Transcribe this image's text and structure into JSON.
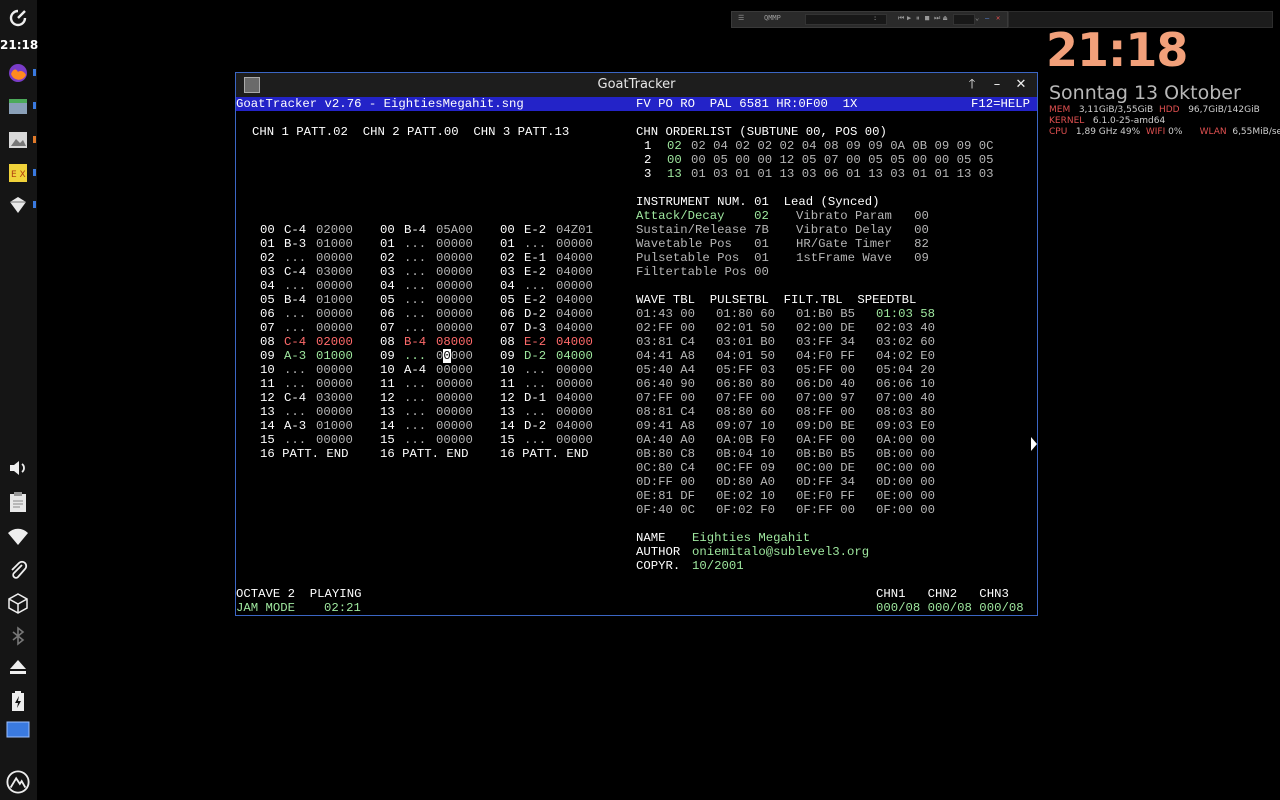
{
  "dock": {
    "time": "21:18",
    "items": [
      "power-icon",
      "firefox-icon",
      "files-icon",
      "image-viewer-icon",
      "notes-icon",
      "media-icon",
      "volume-icon",
      "clipboard-icon",
      "wifi-icon",
      "attachment-icon",
      "package-icon",
      "bluetooth-icon",
      "eject-icon",
      "battery-icon",
      "workspace-icon",
      "logo-icon"
    ],
    "colors": {
      "indicator_blue": "#3a7ae0",
      "indicator_orange": "#e07a2a"
    }
  },
  "qmmp": {
    "title": "QMMP",
    "separator": ":"
  },
  "conky": {
    "clock": "21:18",
    "date": "Sonntag 13 Oktober",
    "mem_label": "MEM",
    "mem_value": "3,11GiB/3,55GiB",
    "hdd_label": "HDD",
    "hdd_value": "96,7GiB/142GiB",
    "kernel_label": "KERNEL",
    "kernel_value": "6.1.0-25-amd64",
    "cpu_label": "CPU",
    "cpu_value": "1,89 GHz  49%",
    "wifi_label": "WIFI",
    "wifi_value": "0%",
    "wlan_label": "WLAN",
    "wlan_value": "6,55MiB/sec",
    "clock_color": "#f2a07a"
  },
  "window": {
    "title": "GoatTracker",
    "header_left": "GoatTracker v2.76 - EightiesMegahit.sng",
    "header_mid": "FV PO RO  PAL 6581 HR:0F00  1X",
    "header_right": "F12=HELP",
    "header_color": "#2323c8"
  },
  "tracker": {
    "chn_header": "CHN 1 PATT.02  CHN 2 PATT.00  CHN 3 PATT.13",
    "orderlist_title": "CHN ORDERLIST (SUBTUNE 00, POS 00)",
    "orderlist": [
      {
        "ch": "1",
        "first": "02",
        "rest": "02 04 02 02 02 04 08 09 09 0A 0B 09 09 0C"
      },
      {
        "ch": "2",
        "first": "00",
        "rest": "00 05 00 00 12 05 07 00 05 05 00 00 05 05"
      },
      {
        "ch": "3",
        "first": "13",
        "rest": "01 03 01 01 13 03 06 01 13 03 01 01 13 03"
      }
    ],
    "instrument": {
      "title": "INSTRUMENT NUM. 01  Lead (Synced)",
      "rows": [
        {
          "l": "Attack/Decay    02",
          "r": "Vibrato Param   00"
        },
        {
          "l": "Sustain/Release 7B",
          "r": "Vibrato Delay   00"
        },
        {
          "l": "Wavetable Pos   01",
          "r": "HR/Gate Timer   82"
        },
        {
          "l": "Pulsetable Pos  01",
          "r": "1stFrame Wave   09"
        },
        {
          "l": "Filtertable Pos 00",
          "r": ""
        }
      ]
    },
    "pattern": [
      [
        "00 C-4 02000",
        "00 B-4 05A00",
        "00 E-2 04Z01"
      ],
      [
        "01 B-3 01000",
        "01 ... 00000",
        "01 ... 00000"
      ],
      [
        "02 ... 00000",
        "02 ... 00000",
        "02 E-1 04000"
      ],
      [
        "03 C-4 03000",
        "03 ... 00000",
        "03 E-2 04000"
      ],
      [
        "04 ... 00000",
        "04 ... 00000",
        "04 ... 00000"
      ],
      [
        "05 B-4 01000",
        "05 ... 00000",
        "05 E-2 04000"
      ],
      [
        "06 ... 00000",
        "06 ... 00000",
        "06 D-2 04000"
      ],
      [
        "07 ... 00000",
        "07 ... 00000",
        "07 D-3 04000"
      ],
      [
        "08 C-4 02000",
        "08 B-4 08000",
        "08 E-2 04000"
      ],
      [
        "09 A-3 01000",
        "09 ... 00000",
        "09 D-2 04000"
      ],
      [
        "10 ... 00000",
        "10 A-4 00000",
        "10 ... 00000"
      ],
      [
        "11 ... 00000",
        "11 ... 00000",
        "11 ... 00000"
      ],
      [
        "12 C-4 03000",
        "12 ... 00000",
        "12 D-1 04000"
      ],
      [
        "13 ... 00000",
        "13 ... 00000",
        "13 ... 00000"
      ],
      [
        "14 A-3 01000",
        "14 ... 00000",
        "14 D-2 04000"
      ],
      [
        "15 ... 00000",
        "15 ... 00000",
        "15 ... 00000"
      ],
      [
        "16 PATT. END",
        "16 PATT. END",
        "16 PATT. END"
      ]
    ],
    "tables_header": "WAVE TBL  PULSETBL  FILT.TBL  SPEEDTBL",
    "tables": [
      [
        "01:43 00",
        "01:80 60",
        "01:B0 B5",
        "01:03 58"
      ],
      [
        "02:FF 00",
        "02:01 50",
        "02:00 DE",
        "02:03 40"
      ],
      [
        "03:81 C4",
        "03:01 B0",
        "03:FF 34",
        "03:02 60"
      ],
      [
        "04:41 A8",
        "04:01 50",
        "04:F0 FF",
        "04:02 E0"
      ],
      [
        "05:40 A4",
        "05:FF 03",
        "05:FF 00",
        "05:04 20"
      ],
      [
        "06:40 90",
        "06:80 80",
        "06:D0 40",
        "06:06 10"
      ],
      [
        "07:FF 00",
        "07:FF 00",
        "07:00 97",
        "07:00 40"
      ],
      [
        "08:81 C4",
        "08:80 60",
        "08:FF 00",
        "08:03 80"
      ],
      [
        "09:41 A8",
        "09:07 10",
        "09:D0 BE",
        "09:03 E0"
      ],
      [
        "0A:40 A0",
        "0A:0B F0",
        "0A:FF 00",
        "0A:00 00"
      ],
      [
        "0B:80 C8",
        "0B:04 10",
        "0B:B0 B5",
        "0B:00 00"
      ],
      [
        "0C:80 C4",
        "0C:FF 09",
        "0C:00 DE",
        "0C:00 00"
      ],
      [
        "0D:FF 00",
        "0D:80 A0",
        "0D:FF 34",
        "0D:00 00"
      ],
      [
        "0E:81 DF",
        "0E:02 10",
        "0E:F0 FF",
        "0E:00 00"
      ],
      [
        "0F:40 0C",
        "0F:02 F0",
        "0F:FF 00",
        "0F:00 00"
      ]
    ],
    "song": {
      "name_label": "NAME  ",
      "name": "Eighties Megahit",
      "author_label": "AUTHOR",
      "author": "oniemitalo@sublevel3.org",
      "copyr_label": "COPYR.",
      "copyr": "10/2001"
    },
    "status": {
      "octave": "OCTAVE 2  PLAYING",
      "mode": "JAM MODE",
      "time": "02:21",
      "chn_labels": "CHN1   CHN2   CHN3",
      "chn_values": "000/08 000/08 000/08"
    }
  }
}
